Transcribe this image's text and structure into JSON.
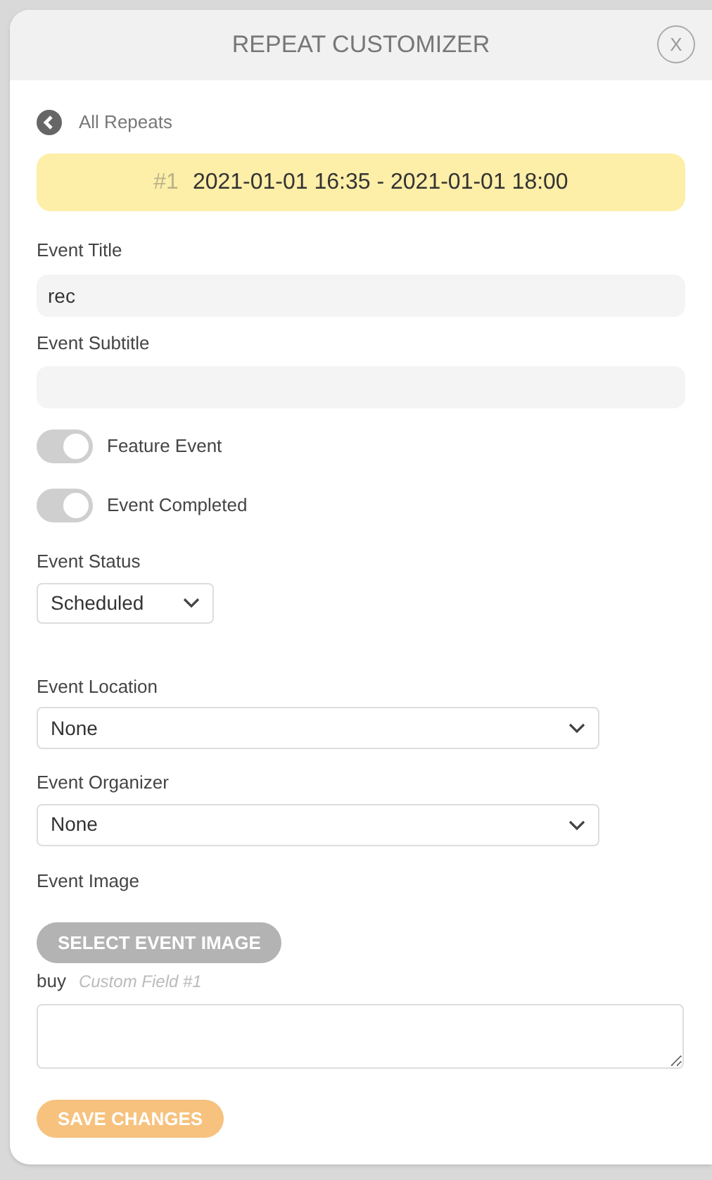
{
  "window": {
    "title": "REPEAT CUSTOMIZER",
    "close": "X"
  },
  "back_link": "All Repeats",
  "occurrence": {
    "number": "#1",
    "range": "2021-01-01 16:35 - 2021-01-01 18:00"
  },
  "fields": [
    {
      "kind": "text",
      "label": "Event Title",
      "value": "rec"
    },
    {
      "kind": "text",
      "label": "Event Subtitle"
    }
  ],
  "toggles": [
    {
      "label": "Feature Event",
      "on": true
    },
    {
      "label": "Event Completed",
      "on": true
    }
  ],
  "status": {
    "label": "Event Status",
    "value": "Scheduled"
  },
  "selects": [
    {
      "label": "Event Location",
      "value": "None"
    },
    {
      "label": "Event Organizer",
      "value": "None"
    }
  ],
  "image": {
    "label": "Event Image",
    "button": "SELECT EVENT IMAGE"
  },
  "custom_field": {
    "label": "buy",
    "hint": "Custom Field #1"
  },
  "save_button": "SAVE CHANGES"
}
